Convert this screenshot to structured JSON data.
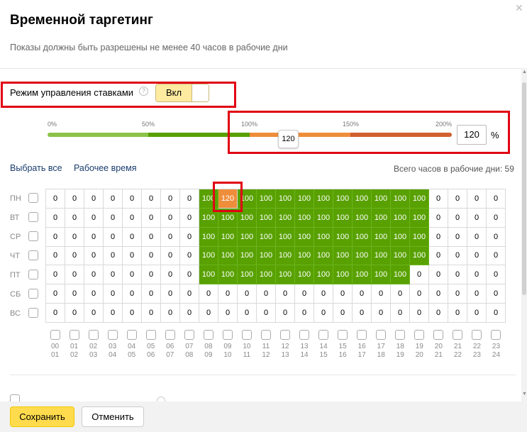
{
  "dialog": {
    "title": "Временной таргетинг",
    "subtitle": "Показы должны быть разрешены не менее 40 часов в рабочие дни",
    "close_icon": "close-icon"
  },
  "bid_mode": {
    "label": "Режим управления ставками",
    "toggle_on_label": "Вкл",
    "toggle_state": "on"
  },
  "scale": {
    "ticks": [
      "0%",
      "50%",
      "100%",
      "150%",
      "200%"
    ],
    "min_percent": 0,
    "max_percent": 200,
    "current_value": "120",
    "input_value": "120",
    "percent_sign": "%",
    "colors": {
      "low": "#8bc34a",
      "mid": "#58a100",
      "high": "#ee8d3a",
      "max": "#d0602f"
    }
  },
  "links": {
    "select_all": "Выбрать все",
    "work_time": "Рабочее время"
  },
  "total_hours_text": "Всего часов в рабочие дни: 59",
  "days": [
    "ПН",
    "ВТ",
    "СР",
    "ЧТ",
    "ПТ",
    "СБ",
    "ВС"
  ],
  "grid": [
    [
      "0",
      "0",
      "0",
      "0",
      "0",
      "0",
      "0",
      "0",
      "100",
      "120",
      "100",
      "100",
      "100",
      "100",
      "100",
      "100",
      "100",
      "100",
      "100",
      "100",
      "0",
      "0",
      "0",
      "0"
    ],
    [
      "0",
      "0",
      "0",
      "0",
      "0",
      "0",
      "0",
      "0",
      "100",
      "100",
      "100",
      "100",
      "100",
      "100",
      "100",
      "100",
      "100",
      "100",
      "100",
      "100",
      "0",
      "0",
      "0",
      "0"
    ],
    [
      "0",
      "0",
      "0",
      "0",
      "0",
      "0",
      "0",
      "0",
      "100",
      "100",
      "100",
      "100",
      "100",
      "100",
      "100",
      "100",
      "100",
      "100",
      "100",
      "100",
      "0",
      "0",
      "0",
      "0"
    ],
    [
      "0",
      "0",
      "0",
      "0",
      "0",
      "0",
      "0",
      "0",
      "100",
      "100",
      "100",
      "100",
      "100",
      "100",
      "100",
      "100",
      "100",
      "100",
      "100",
      "100",
      "0",
      "0",
      "0",
      "0"
    ],
    [
      "0",
      "0",
      "0",
      "0",
      "0",
      "0",
      "0",
      "0",
      "100",
      "100",
      "100",
      "100",
      "100",
      "100",
      "100",
      "100",
      "100",
      "100",
      "100",
      "0",
      "0",
      "0",
      "0",
      "0"
    ],
    [
      "0",
      "0",
      "0",
      "0",
      "0",
      "0",
      "0",
      "0",
      "0",
      "0",
      "0",
      "0",
      "0",
      "0",
      "0",
      "0",
      "0",
      "0",
      "0",
      "0",
      "0",
      "0",
      "0",
      "0"
    ],
    [
      "0",
      "0",
      "0",
      "0",
      "0",
      "0",
      "0",
      "0",
      "0",
      "0",
      "0",
      "0",
      "0",
      "0",
      "0",
      "0",
      "0",
      "0",
      "0",
      "0",
      "0",
      "0",
      "0",
      "0"
    ]
  ],
  "hours": [
    [
      "00",
      "01"
    ],
    [
      "01",
      "02"
    ],
    [
      "02",
      "03"
    ],
    [
      "03",
      "04"
    ],
    [
      "04",
      "05"
    ],
    [
      "05",
      "06"
    ],
    [
      "06",
      "07"
    ],
    [
      "07",
      "08"
    ],
    [
      "08",
      "09"
    ],
    [
      "09",
      "10"
    ],
    [
      "10",
      "11"
    ],
    [
      "11",
      "12"
    ],
    [
      "12",
      "13"
    ],
    [
      "13",
      "14"
    ],
    [
      "14",
      "15"
    ],
    [
      "15",
      "16"
    ],
    [
      "16",
      "17"
    ],
    [
      "17",
      "18"
    ],
    [
      "18",
      "19"
    ],
    [
      "19",
      "20"
    ],
    [
      "20",
      "21"
    ],
    [
      "21",
      "22"
    ],
    [
      "22",
      "23"
    ],
    [
      "23",
      "24"
    ]
  ],
  "buttons": {
    "save": "Сохранить",
    "cancel": "Отменить"
  }
}
